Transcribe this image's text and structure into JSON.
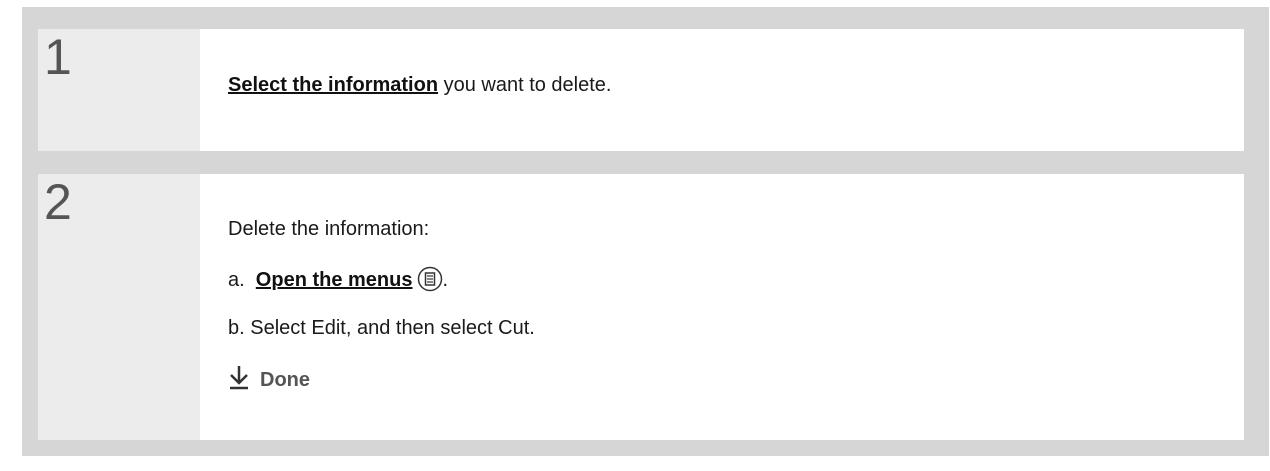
{
  "steps": [
    {
      "number": "1",
      "link_text": "Select the information",
      "rest_text": " you want to delete."
    },
    {
      "number": "2",
      "intro": "Delete the information:",
      "sub_a_prefix": "a.  ",
      "sub_a_link": "Open the menus",
      "sub_a_suffix": ".",
      "sub_b": "b.  Select Edit, and then select Cut.",
      "done_label": "Done"
    }
  ],
  "icons": {
    "menu": "menu-icon",
    "done": "down-arrow-icon"
  }
}
